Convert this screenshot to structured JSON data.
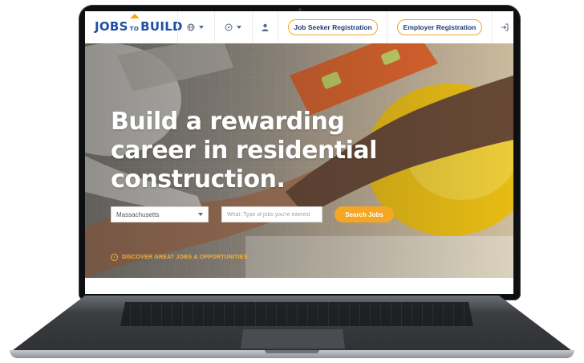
{
  "logo": {
    "jobs": "JOBS",
    "to": "TO",
    "build": "BUILD"
  },
  "header": {
    "language_icon": "globe-icon",
    "location_icon": "compass-icon",
    "user_icon": "user-icon",
    "login_icon": "sign-in-icon",
    "job_seeker_label": "Job Seeker Registration",
    "employer_label": "Employer Registration"
  },
  "hero": {
    "headline_lines": [
      "Build a rewarding",
      "career in residential",
      "construction."
    ],
    "state_select": "Massachusetts",
    "search_placeholder": "What: Type of jobs you're interest",
    "search_button": "Search Jobs",
    "discover_link": "DISCOVER GREAT JOBS & OPPORTUNITIES"
  },
  "colors": {
    "brand_blue": "#1f4fa3",
    "accent_orange": "#f5a623",
    "dark_navy": "#1c3c78"
  }
}
